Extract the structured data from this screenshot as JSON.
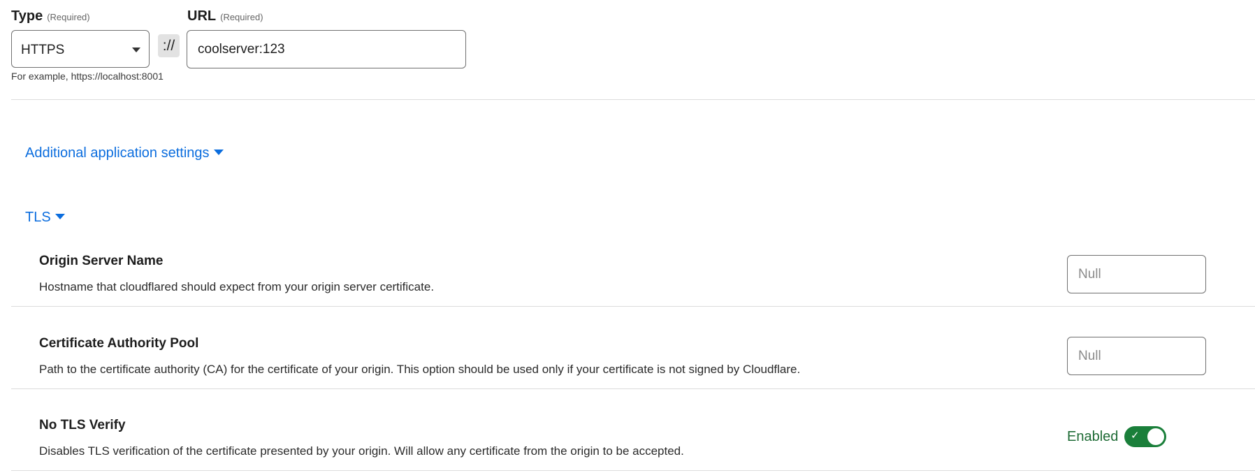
{
  "type_field": {
    "label": "Type",
    "required_note": "(Required)",
    "selected_value": "HTTPS"
  },
  "url_field": {
    "label": "URL",
    "required_note": "(Required)",
    "separator": "://",
    "value": "coolserver:123",
    "hint": "For example, https://localhost:8001"
  },
  "sections": {
    "additional_settings_label": "Additional application settings",
    "tls_label": "TLS"
  },
  "settings": [
    {
      "title": "Origin Server Name",
      "description": "Hostname that cloudflared should expect from your origin server certificate.",
      "placeholder": "Null"
    },
    {
      "title": "Certificate Authority Pool",
      "description": "Path to the certificate authority (CA) for the certificate of your origin. This option should be used only if your certificate is not signed by Cloudflare.",
      "placeholder": "Null"
    },
    {
      "title": "No TLS Verify",
      "description": "Disables TLS verification of the certificate presented by your origin. Will allow any certificate from the origin to be accepted.",
      "toggle_label": "Enabled",
      "toggle_state": true
    }
  ],
  "colors": {
    "link": "#0b6dde",
    "toggle_on": "#1a7f3a",
    "enabled_text": "#1e6b35"
  },
  "icons": {
    "select_caret": "caret-down-icon",
    "section_caret": "triangle-down-icon",
    "toggle_check": "checkmark-icon"
  }
}
